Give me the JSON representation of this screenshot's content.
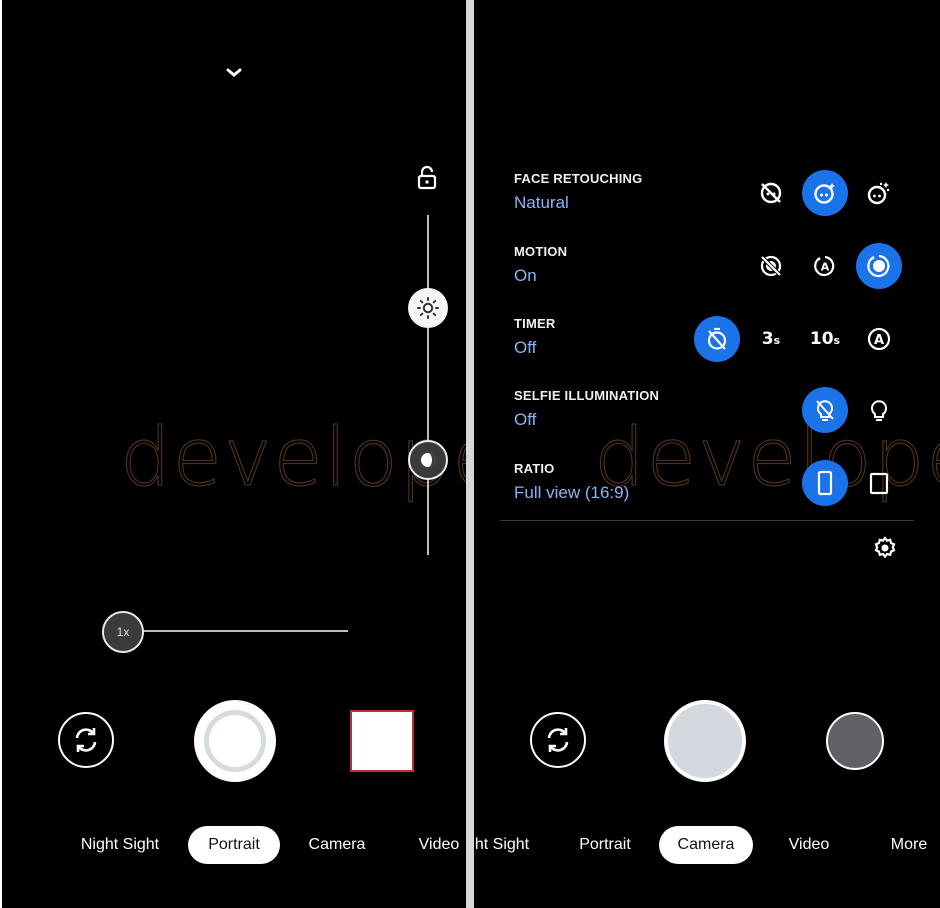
{
  "watermark": "developers",
  "left_screen": {
    "top_chevron_icon": "chevron-down-icon",
    "exposure_lock_icon": "lock-open-icon",
    "brightness_icon": "brightness-sun-icon",
    "contrast_icon": "contrast-icon",
    "zoom_level": "1x",
    "flip_camera_icon": "flip-camera-icon",
    "shutter": "portrait-shutter",
    "thumbnail_border_color": "#b2313a",
    "modes": [
      {
        "label": "Night Sight",
        "active": false
      },
      {
        "label": "Portrait",
        "active": true
      },
      {
        "label": "Camera",
        "active": false
      },
      {
        "label": "Video",
        "active": false
      }
    ]
  },
  "right_screen": {
    "accent_color": "#1a73e8",
    "value_color": "#8ab4f8",
    "settings": [
      {
        "label": "FACE RETOUCHING",
        "value": "Natural",
        "options": [
          {
            "icon": "face-retouch-off-icon",
            "selected": false
          },
          {
            "icon": "face-retouch-natural-icon",
            "selected": true
          },
          {
            "icon": "face-retouch-smooth-icon",
            "selected": false
          }
        ]
      },
      {
        "label": "MOTION",
        "value": "On",
        "options": [
          {
            "icon": "motion-off-icon",
            "selected": false
          },
          {
            "icon": "motion-auto-icon",
            "selected": false
          },
          {
            "icon": "motion-on-icon",
            "selected": true
          }
        ]
      },
      {
        "label": "TIMER",
        "value": "Off",
        "options": [
          {
            "icon": "timer-off-icon",
            "selected": true
          },
          {
            "text": "3",
            "unit": "s",
            "selected": false
          },
          {
            "text": "10",
            "unit": "s",
            "selected": false
          },
          {
            "icon": "timer-auto-icon",
            "selected": false
          }
        ]
      },
      {
        "label": "SELFIE ILLUMINATION",
        "value": "Off",
        "options": [
          {
            "icon": "illumination-off-icon",
            "selected": true
          },
          {
            "icon": "lightbulb-icon",
            "selected": false
          }
        ]
      },
      {
        "label": "RATIO",
        "value": "Full view (16:9)",
        "options": [
          {
            "icon": "ratio-full-icon",
            "selected": true
          },
          {
            "icon": "ratio-4-3-icon",
            "selected": false
          }
        ]
      }
    ],
    "settings_icon": "gear-icon",
    "flip_camera_icon": "flip-camera-icon",
    "modes": [
      {
        "label": "ht Sight",
        "active": false
      },
      {
        "label": "Portrait",
        "active": false
      },
      {
        "label": "Camera",
        "active": true
      },
      {
        "label": "Video",
        "active": false
      },
      {
        "label": "More",
        "active": false
      }
    ]
  }
}
